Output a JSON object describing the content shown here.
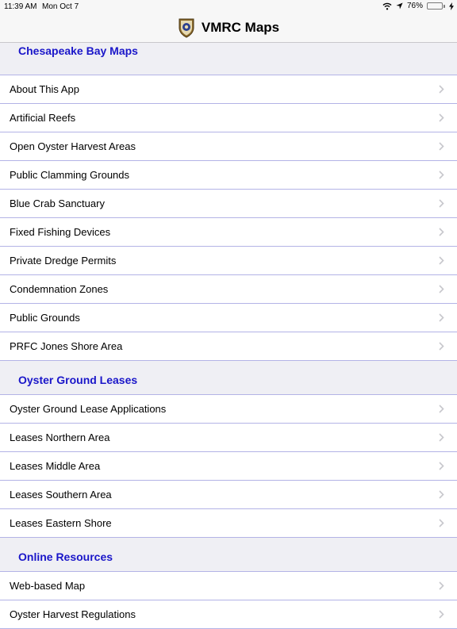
{
  "status_bar": {
    "time": "11:39 AM",
    "date": "Mon Oct 7",
    "battery": "76%"
  },
  "nav": {
    "title": "VMRC Maps"
  },
  "sections": [
    {
      "title": "Chesapeake Bay Maps",
      "items": [
        "About This App",
        "Artificial Reefs",
        "Open Oyster Harvest Areas",
        "Public Clamming Grounds",
        "Blue Crab Sanctuary",
        "Fixed Fishing Devices",
        "Private Dredge Permits",
        "Condemnation Zones",
        "Public Grounds",
        "PRFC Jones Shore Area"
      ]
    },
    {
      "title": "Oyster Ground Leases",
      "items": [
        "Oyster Ground Lease Applications",
        "Leases Northern Area",
        "Leases Middle Area",
        "Leases Southern Area",
        "Leases Eastern Shore"
      ]
    },
    {
      "title": "Online Resources",
      "items": [
        "Web-based Map",
        "Oyster Harvest Regulations"
      ]
    }
  ],
  "colors": {
    "section_title": "#1a16c9",
    "separator": "#b3b3e6",
    "background": "#efeff4",
    "battery": "#4cd964"
  }
}
